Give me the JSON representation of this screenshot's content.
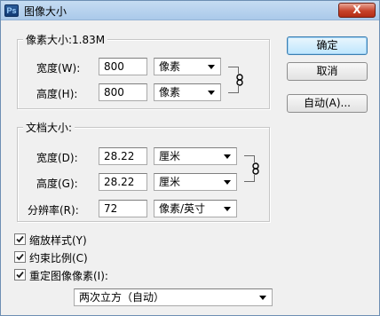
{
  "window": {
    "title": "图像大小",
    "icon_label": "Ps",
    "close_label": "X"
  },
  "pixel_dimensions": {
    "legend": "像素大小:1.83M",
    "width_label": "宽度(W):",
    "width_value": "800",
    "width_unit": "像素",
    "height_label": "高度(H):",
    "height_value": "800",
    "height_unit": "像素",
    "link_icon": "chain-link-icon"
  },
  "document_size": {
    "legend": "文档大小:",
    "width_label": "宽度(D):",
    "width_value": "28.22",
    "width_unit": "厘米",
    "height_label": "高度(G):",
    "height_value": "28.22",
    "height_unit": "厘米",
    "resolution_label": "分辨率(R):",
    "resolution_value": "72",
    "resolution_unit": "像素/英寸",
    "link_icon": "chain-link-icon"
  },
  "options": {
    "scale_styles": {
      "label": "缩放样式(Y)",
      "checked": true
    },
    "constrain_proportions": {
      "label": "约束比例(C)",
      "checked": true
    },
    "resample_image": {
      "label": "重定图像像素(I):",
      "checked": true
    },
    "resample_method": "两次立方（自动）"
  },
  "buttons": {
    "ok": "确定",
    "cancel": "取消",
    "auto": "自动(A)..."
  }
}
